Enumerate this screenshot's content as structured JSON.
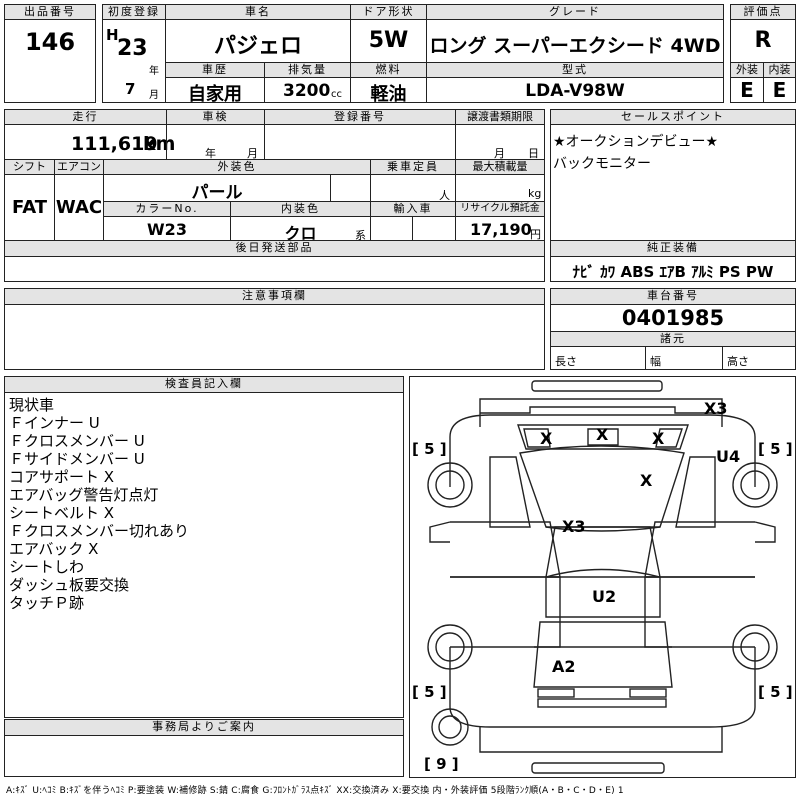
{
  "header": {
    "lot_no_label": "出品番号",
    "lot_no": "146",
    "first_reg_label": "初度登録",
    "era_letter": "H",
    "year": "23",
    "year_unit": "年",
    "month": "7",
    "month_unit": "月",
    "car_name_label": "車名",
    "car_name": "パジェロ",
    "door_label": "ドア形状",
    "doors": "5W",
    "grade_label": "グレード",
    "grade": "ロング スーパーエクシード 4WD",
    "score_label": "評価点",
    "score": "R",
    "history_label": "車歴",
    "history": "自家用",
    "displacement_label": "排気量",
    "displacement": "3200",
    "displacement_unit": "cc",
    "fuel_label": "燃料",
    "fuel": "軽油",
    "model_label": "型式",
    "model": "LDA-V98W",
    "exterior_label": "外装",
    "exterior_grade": "E",
    "interior_label": "内装",
    "interior_grade": "E"
  },
  "row2": {
    "mileage_label": "走行",
    "mileage": "111,619",
    "mileage_unit": "km",
    "inspection_label": "車検",
    "inspection_year_unit": "年",
    "inspection_month_unit": "月",
    "plate_label": "登録番号",
    "transfer_label": "譲渡書類期限",
    "transfer_month_unit": "月",
    "transfer_day_unit": "日",
    "sales_point_label": "セールスポイント",
    "sales_points": [
      "★オークションデビュー★",
      "バックモニター"
    ]
  },
  "row3": {
    "shift_label": "シフト",
    "shift": "FAT",
    "ac_label": "エアコン",
    "ac": "WAC",
    "exterior_color_label": "外装色",
    "exterior_color": "パール",
    "capacity_label": "乗車定員",
    "capacity_unit": "人",
    "max_load_label": "最大積載量",
    "max_load_unit": "kg",
    "color_no_label": "カラーNo.",
    "color_no": "W23",
    "interior_color_label": "内装色",
    "interior_color": "クロ",
    "interior_color_unit": "系",
    "import_label": "輸入車",
    "recycle_label": "リサイクル預託金",
    "recycle": "17,190",
    "recycle_unit": "円"
  },
  "later_parts_label": "後日発送部品",
  "equipment_label": "純正装備",
  "equipment": "ﾅﾋﾞ ｶﾜ ABS ｴｱB ｱﾙﾐ PS PW",
  "caution_label": "注意事項欄",
  "chassis_label": "車台番号",
  "chassis_no": "0401985",
  "specs_label": "諸元",
  "length_label": "長さ",
  "width_label": "幅",
  "height_label": "高さ",
  "inspector_label": "検査員記入欄",
  "inspector_notes": [
    "現状車",
    "Ｆインナー U",
    "Ｆクロスメンバー U",
    "Ｆサイドメンバー U",
    "コアサポート X",
    "エアバッグ警告灯点灯",
    "シートベルト X",
    "Ｆクロスメンバー切れあり",
    "エアバック X",
    "シートしわ",
    "ダッシュ板要交換",
    "タッチＰ跡"
  ],
  "office_label": "事務局よりご案内",
  "diagram": {
    "marks": {
      "rear_gate": "X3",
      "rear_glass_left": "X",
      "rear_glass_mid": "X",
      "rear_glass_right": "X",
      "roof": "X",
      "rear_right": "U4",
      "center": "X3",
      "front_area": "U2",
      "hood": "A2"
    },
    "tire_rear_left": "5",
    "tire_rear_right": "5",
    "tire_front_left": "5",
    "tire_front_right": "5",
    "spare_tire": "9"
  },
  "legend": "A:ｷｽﾞ U:ﾍｺﾐ B:ｷｽﾞを伴うﾍｺﾐ P:要塗装 W:補修跡 S:錆 C:腐食 G:ﾌﾛﾝﾄｶﾞﾗｽ点ｷｽﾞ XX:交換済み X:要交換 内・外装評価 5段階ﾗﾝｸ順(A・B・C・D・E) 1"
}
